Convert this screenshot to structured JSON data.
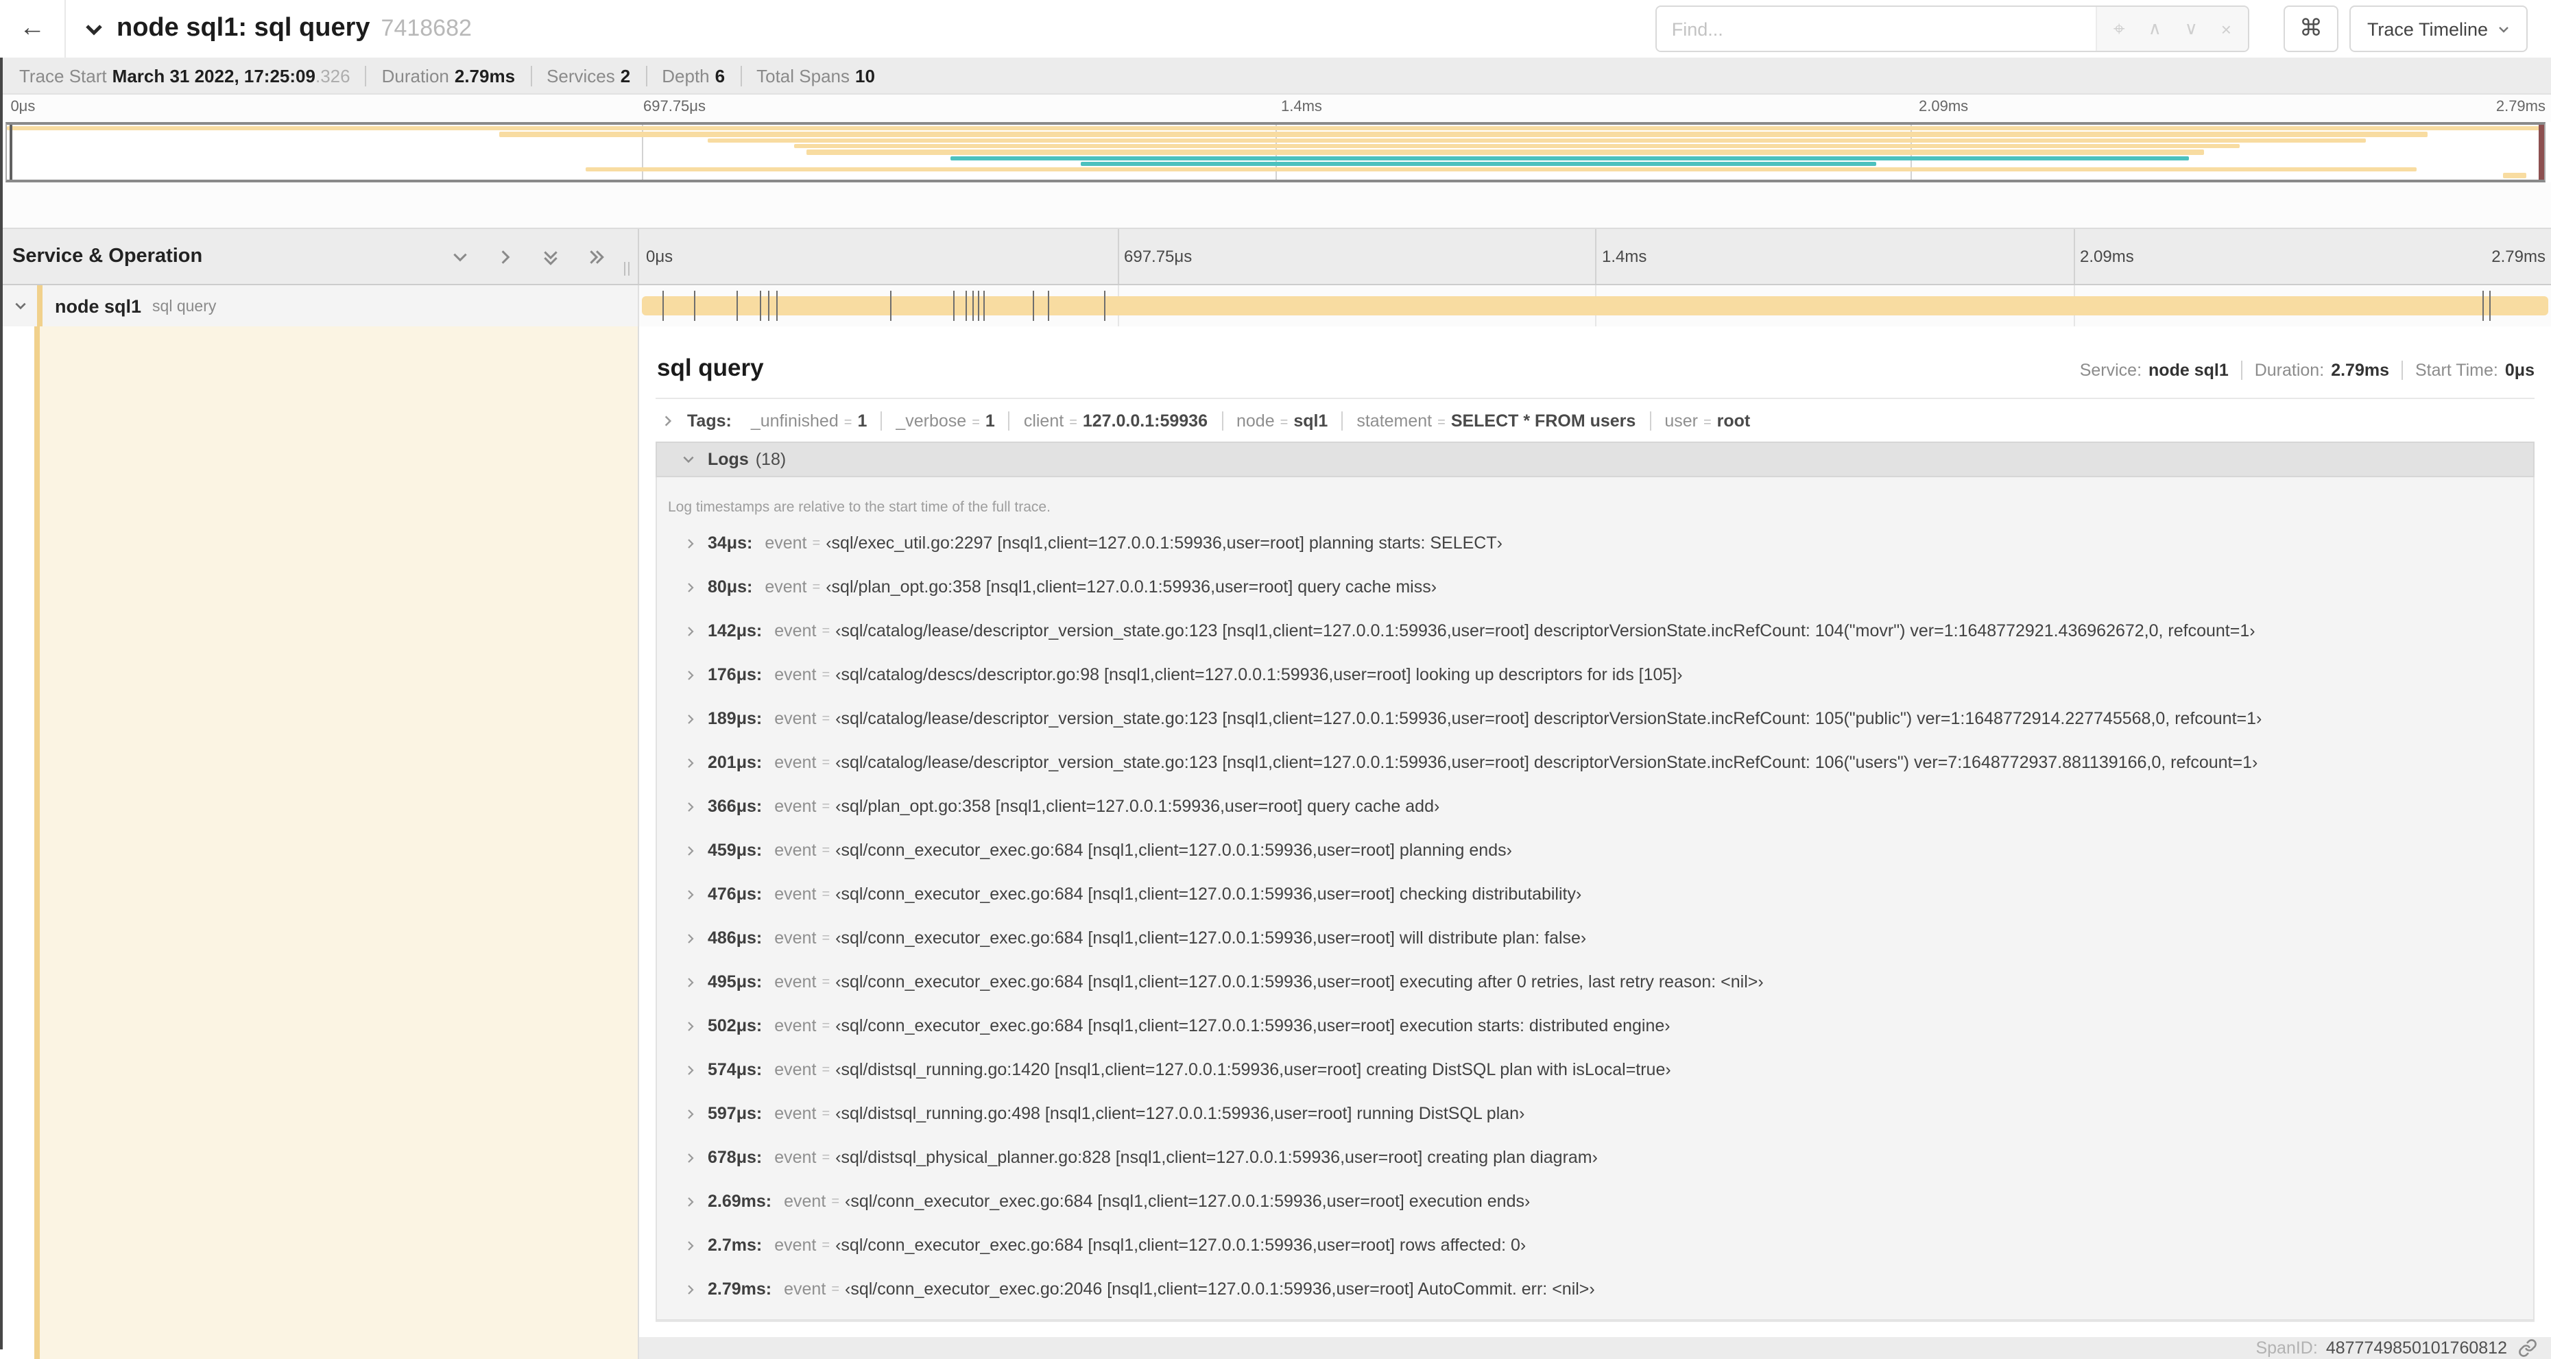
{
  "ui": {
    "eq": "="
  },
  "topbar": {
    "back_icon": "←",
    "title": "node sql1: sql query",
    "trace_id": "7418682",
    "find_placeholder": "Find...",
    "find_icons": {
      "locate": "⌖",
      "prev": "∧",
      "next": "∨",
      "clear": "×"
    },
    "shortcut_icon": "⌘",
    "view_button": "Trace Timeline"
  },
  "meta": {
    "items": [
      {
        "label": "Trace Start",
        "value": "March 31 2022, 17:25:09",
        "suffix": ".326"
      },
      {
        "label": "Duration",
        "value": "2.79ms",
        "suffix": ""
      },
      {
        "label": "Services",
        "value": "2",
        "suffix": ""
      },
      {
        "label": "Depth",
        "value": "6",
        "suffix": ""
      },
      {
        "label": "Total Spans",
        "value": "10",
        "suffix": ""
      }
    ]
  },
  "timeline": {
    "duration_us": 2790,
    "ticks": [
      "0μs",
      "697.75μs",
      "1.4ms",
      "2.09ms",
      "2.79ms"
    ]
  },
  "minimap": {
    "span_color": "#F8DCA1",
    "remote_color": "#4CC1BE",
    "rows": [
      {
        "color": "#F8DCA1",
        "start": 0,
        "end": 100
      },
      {
        "color": "#F8DCA1",
        "start": 19.4,
        "end": 95.4
      },
      {
        "color": "#F8DCA1",
        "start": 27.6,
        "end": 93
      },
      {
        "color": "#F8DCA1",
        "start": 31,
        "end": 88
      },
      {
        "color": "#F8DCA1",
        "start": 31.5,
        "end": 86.6
      },
      {
        "color": "#4CC1BE",
        "start": 37.2,
        "end": 86
      },
      {
        "color": "#4CC1BE",
        "start": 42.3,
        "end": 73.7
      },
      {
        "color": "#F8DCA1",
        "start": 22.8,
        "end": 95
      },
      {
        "color": "#F8DCA1",
        "start": 98.4,
        "end": 99.3
      }
    ]
  },
  "grid": {
    "left_title": "Service & Operation"
  },
  "span_row": {
    "service": "node sql1",
    "operation": "sql query"
  },
  "detail": {
    "operation": "sql query",
    "overview": [
      {
        "label": "Service:",
        "value": "node sql1"
      },
      {
        "label": "Duration:",
        "value": "2.79ms"
      },
      {
        "label": "Start Time:",
        "value": "0μs"
      }
    ],
    "tags_label": "Tags:",
    "tags": [
      {
        "key": "_unfinished",
        "value": "1"
      },
      {
        "key": "_verbose",
        "value": "1"
      },
      {
        "key": "client",
        "value": "127.0.0.1:59936"
      },
      {
        "key": "node",
        "value": "sql1"
      },
      {
        "key": "statement",
        "value": "SELECT * FROM users"
      },
      {
        "key": "user",
        "value": "root"
      }
    ],
    "logs_label": "Logs",
    "logs_count": "(18)",
    "logs": [
      {
        "t": "34μs:",
        "t_us": 34,
        "field": "event",
        "value": "‹sql/exec_util.go:2297 [nsql1,client=127.0.0.1:59936,user=root] planning starts: SELECT›"
      },
      {
        "t": "80μs:",
        "t_us": 80,
        "field": "event",
        "value": "‹sql/plan_opt.go:358 [nsql1,client=127.0.0.1:59936,user=root] query cache miss›"
      },
      {
        "t": "142μs:",
        "t_us": 142,
        "field": "event",
        "value": "‹sql/catalog/lease/descriptor_version_state.go:123 [nsql1,client=127.0.0.1:59936,user=root] descriptorVersionState.incRefCount: 104(\"movr\") ver=1:1648772921.436962672,0, refcount=1›"
      },
      {
        "t": "176μs:",
        "t_us": 176,
        "field": "event",
        "value": "‹sql/catalog/descs/descriptor.go:98 [nsql1,client=127.0.0.1:59936,user=root] looking up descriptors for ids [105]›"
      },
      {
        "t": "189μs:",
        "t_us": 189,
        "field": "event",
        "value": "‹sql/catalog/lease/descriptor_version_state.go:123 [nsql1,client=127.0.0.1:59936,user=root] descriptorVersionState.incRefCount: 105(\"public\") ver=1:1648772914.227745568,0, refcount=1›"
      },
      {
        "t": "201μs:",
        "t_us": 201,
        "field": "event",
        "value": "‹sql/catalog/lease/descriptor_version_state.go:123 [nsql1,client=127.0.0.1:59936,user=root] descriptorVersionState.incRefCount: 106(\"users\") ver=7:1648772937.881139166,0, refcount=1›"
      },
      {
        "t": "366μs:",
        "t_us": 366,
        "field": "event",
        "value": "‹sql/plan_opt.go:358 [nsql1,client=127.0.0.1:59936,user=root] query cache add›"
      },
      {
        "t": "459μs:",
        "t_us": 459,
        "field": "event",
        "value": "‹sql/conn_executor_exec.go:684 [nsql1,client=127.0.0.1:59936,user=root] planning ends›"
      },
      {
        "t": "476μs:",
        "t_us": 476,
        "field": "event",
        "value": "‹sql/conn_executor_exec.go:684 [nsql1,client=127.0.0.1:59936,user=root] checking distributability›"
      },
      {
        "t": "486μs:",
        "t_us": 486,
        "field": "event",
        "value": "‹sql/conn_executor_exec.go:684 [nsql1,client=127.0.0.1:59936,user=root] will distribute plan: false›"
      },
      {
        "t": "495μs:",
        "t_us": 495,
        "field": "event",
        "value": "‹sql/conn_executor_exec.go:684 [nsql1,client=127.0.0.1:59936,user=root] executing after 0 retries, last retry reason: <nil>›"
      },
      {
        "t": "502μs:",
        "t_us": 502,
        "field": "event",
        "value": "‹sql/conn_executor_exec.go:684 [nsql1,client=127.0.0.1:59936,user=root] execution starts: distributed engine›"
      },
      {
        "t": "574μs:",
        "t_us": 574,
        "field": "event",
        "value": "‹sql/distsql_running.go:1420 [nsql1,client=127.0.0.1:59936,user=root] creating DistSQL plan with isLocal=true›"
      },
      {
        "t": "597μs:",
        "t_us": 597,
        "field": "event",
        "value": "‹sql/distsql_running.go:498 [nsql1,client=127.0.0.1:59936,user=root] running DistSQL plan›"
      },
      {
        "t": "678μs:",
        "t_us": 678,
        "field": "event",
        "value": "‹sql/distsql_physical_planner.go:828 [nsql1,client=127.0.0.1:59936,user=root] creating plan diagram›"
      },
      {
        "t": "2.69ms:",
        "t_us": 2690,
        "field": "event",
        "value": "‹sql/conn_executor_exec.go:684 [nsql1,client=127.0.0.1:59936,user=root] execution ends›"
      },
      {
        "t": "2.7ms:",
        "t_us": 2700,
        "field": "event",
        "value": "‹sql/conn_executor_exec.go:684 [nsql1,client=127.0.0.1:59936,user=root] rows affected: 0›"
      },
      {
        "t": "2.79ms:",
        "t_us": 2790,
        "field": "event",
        "value": "‹sql/conn_executor_exec.go:2046 [nsql1,client=127.0.0.1:59936,user=root] AutoCommit. err: <nil>›"
      }
    ],
    "note": "Log timestamps are relative to the start time of the full trace.",
    "spanid_label": "SpanID:",
    "spanid": "4877749850101760812"
  }
}
